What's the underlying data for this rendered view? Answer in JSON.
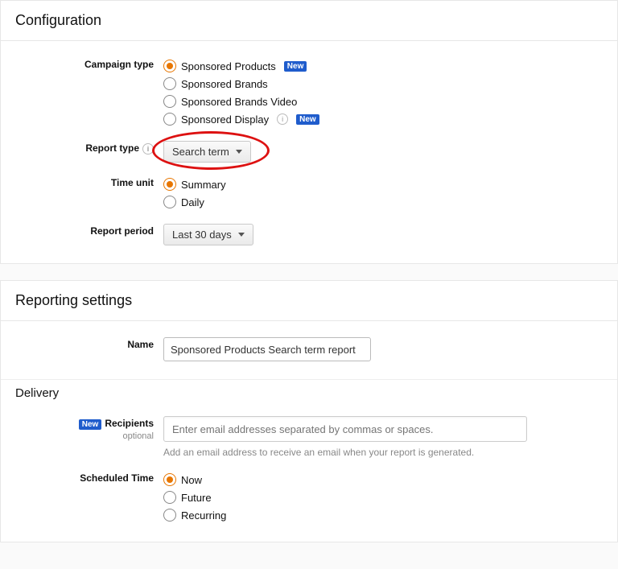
{
  "config": {
    "title": "Configuration",
    "campaign_label": "Campaign type",
    "campaign_opts": [
      {
        "label": "Sponsored Products",
        "new": true
      },
      {
        "label": "Sponsored Brands",
        "new": false
      },
      {
        "label": "Sponsored Brands Video",
        "new": false
      },
      {
        "label": "Sponsored Display",
        "new": true,
        "info": true
      }
    ],
    "campaign_selected": 0,
    "report_type_label": "Report type",
    "report_type_value": "Search term",
    "time_unit_label": "Time unit",
    "time_unit_opts": [
      {
        "label": "Summary"
      },
      {
        "label": "Daily"
      }
    ],
    "time_unit_selected": 0,
    "report_period_label": "Report period",
    "report_period_value": "Last 30 days"
  },
  "settings": {
    "title": "Reporting settings",
    "name_label": "Name",
    "name_value": "Sponsored Products Search term report"
  },
  "delivery": {
    "title": "Delivery",
    "recipients_label": "Recipients",
    "recipients_sub": "optional",
    "recipients_placeholder": "Enter email addresses separated by commas or spaces.",
    "recipients_hint": "Add an email address to receive an email when your report is generated.",
    "sched_label": "Scheduled Time",
    "sched_opts": [
      {
        "label": "Now"
      },
      {
        "label": "Future"
      },
      {
        "label": "Recurring"
      }
    ],
    "sched_selected": 0
  },
  "badge_new": "New"
}
